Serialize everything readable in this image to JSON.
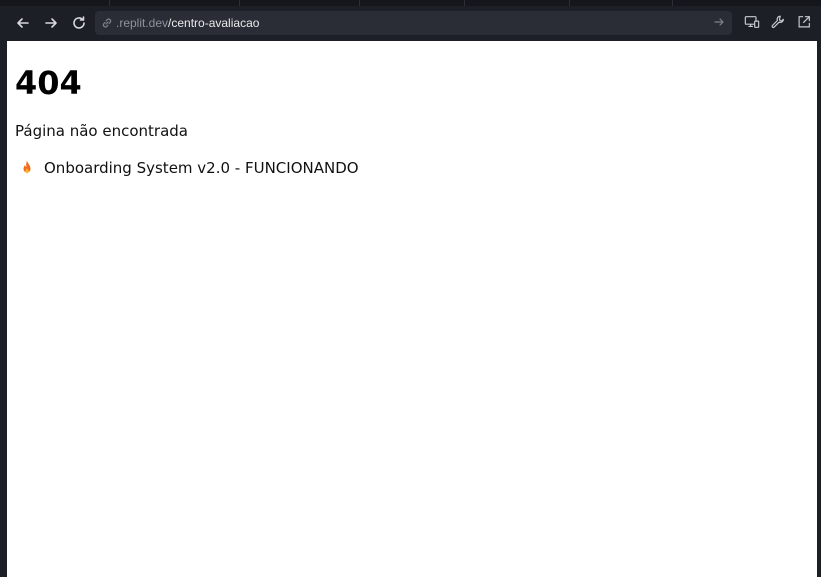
{
  "browser": {
    "url_domain": ".replit.dev",
    "url_path": "/centro-avaliacao",
    "icons": [
      "back-arrow-icon",
      "forward-arrow-icon",
      "reload-icon",
      "link-icon",
      "go-arrow-icon",
      "devices-icon",
      "wrench-icon",
      "open-external-icon"
    ]
  },
  "page": {
    "heading": "404",
    "message": "Página não encontrada",
    "status_icon": "fire-icon",
    "status_text": "Onboarding System v2.0 - FUNCIONANDO"
  },
  "colors": {
    "chrome_bg": "#1c1f26",
    "url_bar_bg": "#2a2d36",
    "page_bg": "#ffffff",
    "flame": "#f26b1d"
  }
}
